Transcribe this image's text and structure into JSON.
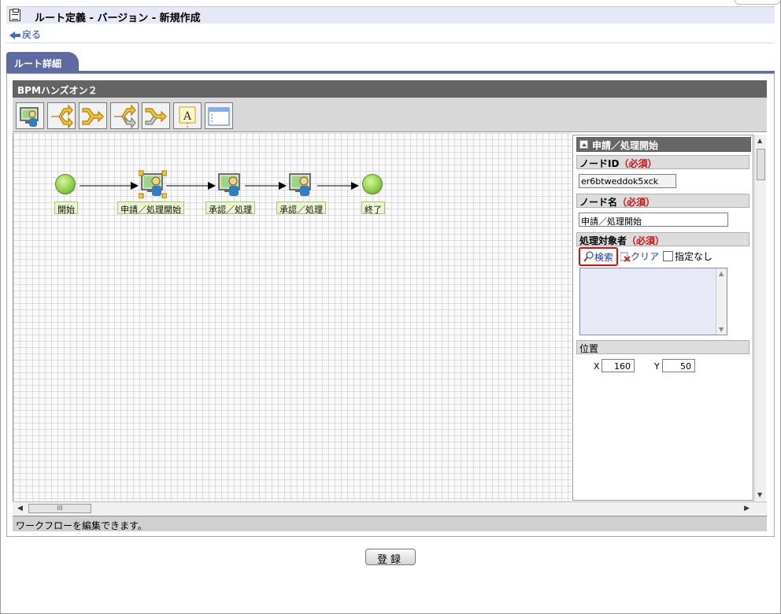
{
  "header": {
    "title": "ルート定義 - バージョン - 新規作成",
    "back_label": "戻る"
  },
  "tab": {
    "label": "ルート詳細"
  },
  "editor": {
    "route_name": "BPMハンズオン２",
    "toolbar": [
      {
        "icon": "task-node-icon"
      },
      {
        "icon": "branch-icon"
      },
      {
        "icon": "merge-icon"
      },
      {
        "icon": "branch-gray-icon"
      },
      {
        "icon": "merge-gray-icon"
      },
      {
        "icon": "text-annotation-icon"
      },
      {
        "icon": "window-icon"
      }
    ],
    "nodes": {
      "start": "開始",
      "apply": "申請／処理開始",
      "approve1": "承認／処理",
      "approve2": "承認／処理",
      "end": "終了"
    },
    "status": "ワークフローを編集できます。",
    "scroll_thumb": "III"
  },
  "properties": {
    "title": "申請／処理開始",
    "node_id_label": "ノードID",
    "node_id_value": "er6btweddok5xck",
    "node_name_label": "ノード名",
    "node_name_value": "申請／処理開始",
    "target_label": "処理対象者",
    "required": "（必須）",
    "search_label": "検索",
    "clear_label": "クリア",
    "unspecified_label": "指定なし",
    "position_label": "位置",
    "x_label": "X",
    "x_value": "160",
    "y_label": "Y",
    "y_value": "50"
  },
  "footer": {
    "submit_label": "登録"
  },
  "colors": {
    "tab": "#5d6ba2",
    "required": "#d01010",
    "link": "#1a3ca8",
    "node_label_bg": "#e9f5cf"
  }
}
